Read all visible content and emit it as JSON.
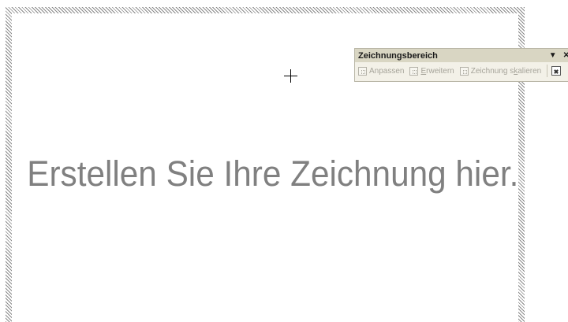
{
  "canvas": {
    "placeholder_text": "Erstellen Sie Ihre Zeichnung hier."
  },
  "toolbar": {
    "title": "Zeichnungsbereich",
    "dropdown_glyph": "▼",
    "close_glyph": "✕",
    "buttons": [
      {
        "label_before": "",
        "label_underlined": "",
        "label_after": "Anpassen",
        "icon": "fit-icon",
        "enabled": false
      },
      {
        "label_before": "",
        "label_underlined": "E",
        "label_after": "rweitern",
        "icon": "expand-icon",
        "enabled": false
      },
      {
        "label_before": "Zeichnung s",
        "label_underlined": "k",
        "label_after": "alieren",
        "icon": "scale-drawing-icon",
        "enabled": false
      }
    ],
    "last_button": {
      "icon": "text-wrapping-icon",
      "enabled": true
    }
  },
  "colors": {
    "placeholder_text": "#808080",
    "toolbar_bg": "#f3f1e8",
    "toolbar_title_bg": "#d9d6c3",
    "disabled_text": "#a6a49a"
  }
}
